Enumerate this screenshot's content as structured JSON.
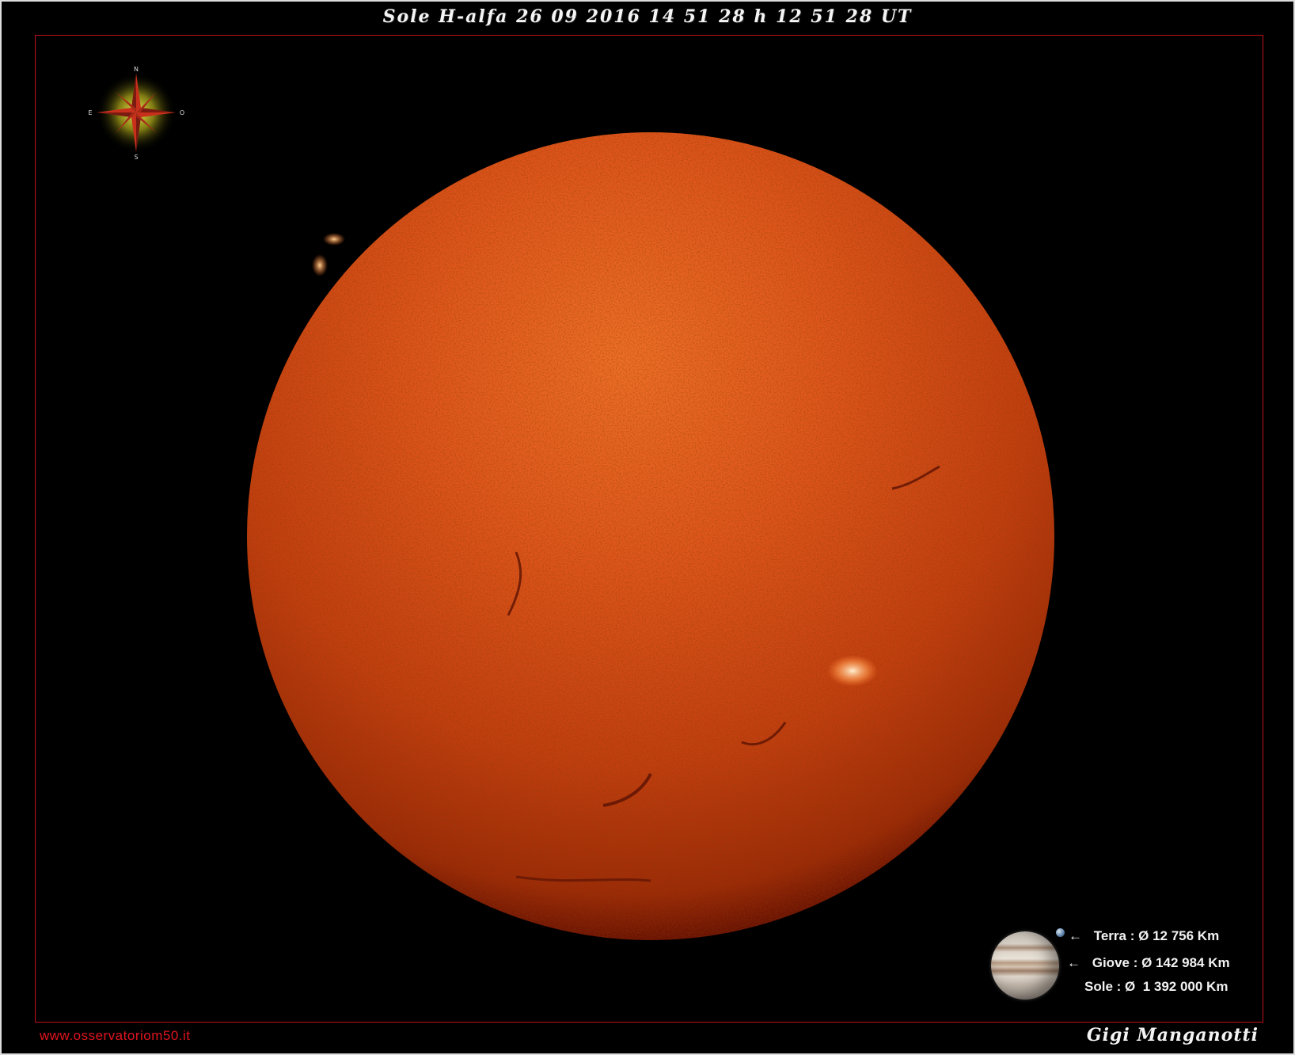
{
  "title": "Sole H-alfa 26 09 2016 14 51 28 h 12 51 28 UT",
  "compass": {
    "north": "N",
    "south": "S",
    "east": "E",
    "west": "O",
    "icon": "compass-rose-icon"
  },
  "legend": {
    "rows": [
      {
        "arrow": "←",
        "label": "Terra :",
        "value": "Ø 12 756 Km"
      },
      {
        "arrow": "←",
        "label": "Giove :",
        "value": "Ø 142 984 Km"
      },
      {
        "arrow": "",
        "label": "Sole :",
        "value": "Ø  1 392 000 Km"
      }
    ]
  },
  "footer": {
    "website": "www.osservatoriom50.it",
    "author": "Gigi Manganotti"
  },
  "colors": {
    "frame": "#c0101a",
    "sun_core": "#e0561c",
    "sun_limb": "#7a1404",
    "website": "#e0141e"
  }
}
